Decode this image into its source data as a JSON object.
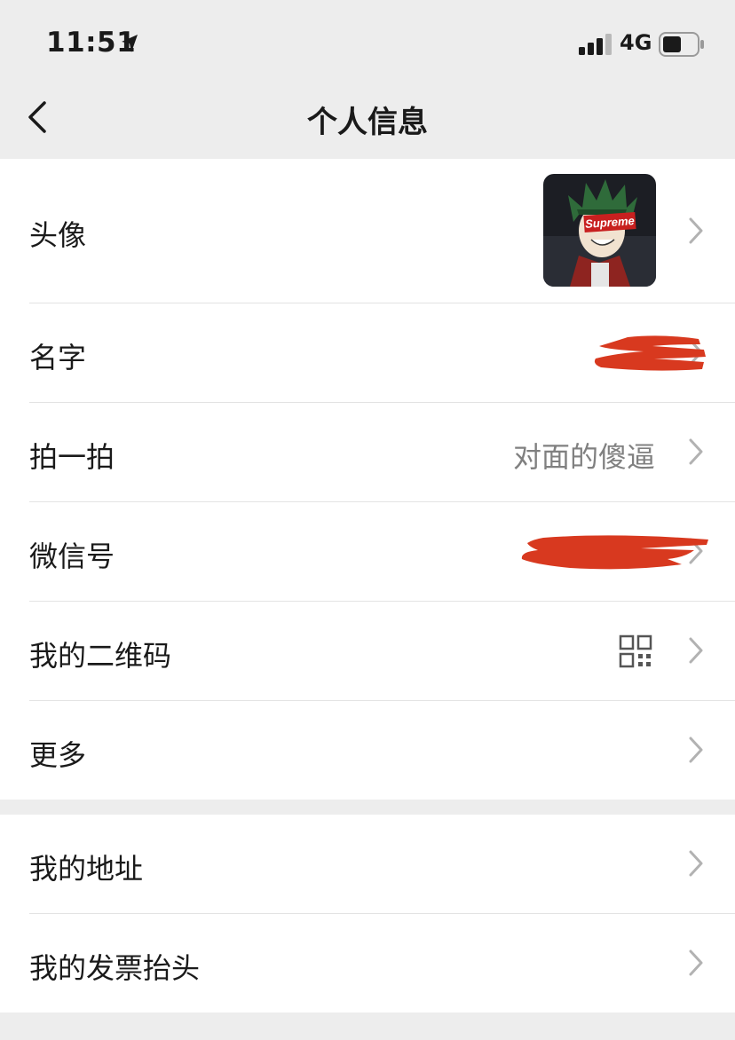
{
  "status_bar": {
    "time": "11:51",
    "network": "4G",
    "icons": [
      "location-arrow-icon",
      "cell-signal-icon",
      "battery-icon"
    ]
  },
  "nav": {
    "title": "个人信息",
    "back_icon": "chevron-left-icon"
  },
  "profile_items": [
    {
      "label": "头像",
      "trailing": "avatar-image"
    },
    {
      "label": "名字",
      "trailing": "redacted"
    },
    {
      "label": "拍一拍",
      "value": "对面的傻逼"
    },
    {
      "label": "微信号",
      "trailing": "redacted"
    },
    {
      "label": "我的二维码",
      "trailing": "qr-code-icon"
    },
    {
      "label": "更多"
    }
  ],
  "extra_items": [
    {
      "label": "我的地址"
    },
    {
      "label": "我的发票抬头"
    }
  ],
  "avatar": {
    "badge_text": "Supreme"
  },
  "colors": {
    "background": "#ededed",
    "card": "#ffffff",
    "divider": "#e3e3e3",
    "secondary_text": "#808080",
    "chevron": "#b2b2b2",
    "redaction": "#d8391f",
    "badge": "#c8201f"
  }
}
